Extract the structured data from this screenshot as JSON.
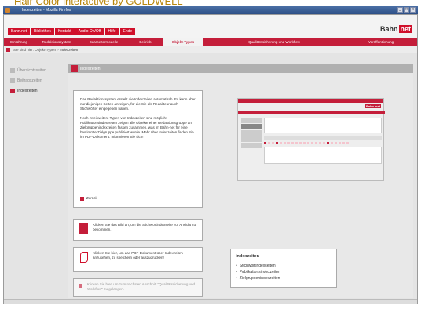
{
  "caption": "Hair Color interactive by GOLDWELL",
  "window": {
    "title": "Indexzeiten - Mozilla Firefox",
    "min": "_",
    "max": "□",
    "close": "x"
  },
  "topbar": {
    "tabs": [
      "Bahn.net",
      "Bibliothek",
      "Kontakt",
      "Audio On/Off",
      "Hilfe",
      "Ende"
    ],
    "logo_left": "Bahn",
    "logo_right": "net"
  },
  "mainnav": [
    {
      "label": "Einführung",
      "active": false
    },
    {
      "label": "Redaktionssystem",
      "active": false
    },
    {
      "label": "Bearbeitermodelle",
      "active": false
    },
    {
      "label": "Beitrieb",
      "active": false
    },
    {
      "label": "Objekt-Typen",
      "active": true
    },
    {
      "label": "Qualitätssicherung und Workflow",
      "active": false
    },
    {
      "label": "Veröffentlichung",
      "active": false
    }
  ],
  "breadcrumb": {
    "prefix": "Sie sind hier:",
    "path": "Objekt-Typen",
    "sep": " > ",
    "current": "Indexzeiten"
  },
  "sidebar": {
    "items": [
      "Übersichtsseiten",
      "Beitragszeiten",
      "Indexzeiten"
    ],
    "active_index": 2
  },
  "content": {
    "title": "Indexzeiten",
    "paragraphs": [
      "Das Redaktionssystem erstellt die Indexzeiten automatisch. Es kann aber nur diejenigen Seiten anzeigen, für die Sie als Redakteur auch Stichwörter eingegeben haben.",
      "Noch zwei weitere Typen von Indexzeiten sind möglich: Publikationsindexzeiten zeigen alle Objekte einer Redaktionsgruppe an. Zielgruppenindexzeiten fassen zusammen, was im Bahn-net für eine bestimmte Zielgruppe publiziert wurde. Mehr über Indexzeiten finden Sie im PDF-Dokument. Informieren Sie sich!"
    ],
    "back": "Zurück",
    "cta": [
      "Klicken Sie das Bild an, um die Stichwortindexseite zur Ansicht zu bekommen.",
      "Klicken Sie hier, um das PDF-Dokument über Indexzeiten anzusehen, zu speichern oder auszudrucken!",
      "Klicken Sie hier, um zum nächsten Abschnitt \"Qualitätssicherung und Workflow\" zu gelangen."
    ],
    "infobox": {
      "title": "Indexzeiten",
      "items": [
        "Stichwortindexseiten",
        "Publikationsindexzeiten",
        "Zielgruppenindexzeiten"
      ]
    }
  },
  "preview": {
    "logo_left": "Bahn",
    "logo_right": "net"
  }
}
